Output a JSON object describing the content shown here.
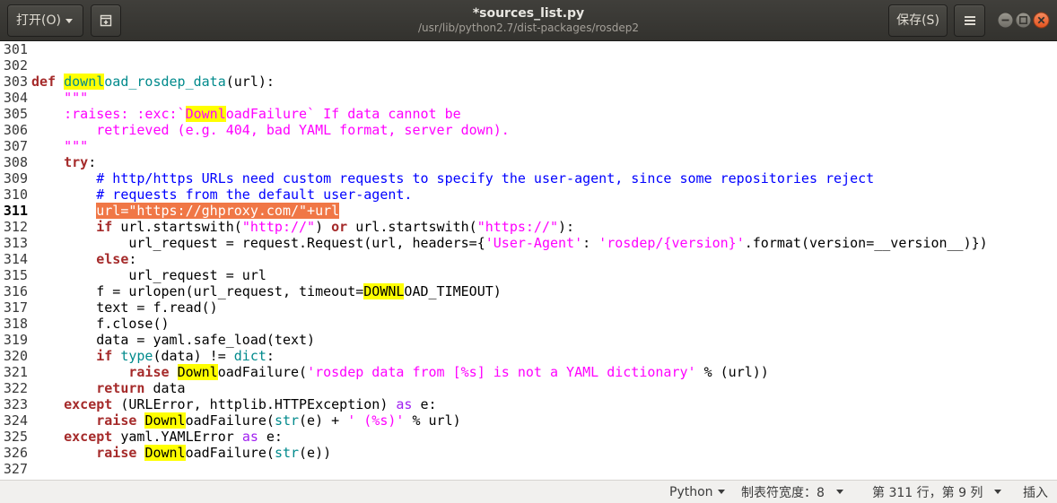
{
  "window": {
    "title": "*sources_list.py",
    "subtitle": "/usr/lib/python2.7/dist-packages/rosdep2"
  },
  "header": {
    "open_label": "打开(O)",
    "save_label": "保存(S)",
    "icons": {
      "open_dropdown": "chevron-down-icon",
      "new_tab": "new-tab-icon",
      "menu": "hamburger-menu-icon",
      "minimize": "minimize-icon",
      "maximize": "maximize-icon",
      "close": "close-icon"
    }
  },
  "syntax_colors": {
    "keyword": "#a52a2a",
    "function": "#008a8c",
    "string": "#ff00ff",
    "comment": "#0000ff",
    "preprocessor": "#a020f0",
    "search_match_background": "#ffff00",
    "selection_background": "#f07746",
    "selection_text": "#ffffff",
    "window_close": "#ef6a3b"
  },
  "editor": {
    "lines": [
      {
        "num": "301",
        "tokens": []
      },
      {
        "num": "302",
        "tokens": []
      },
      {
        "num": "303",
        "tokens": [
          {
            "t": "def",
            "fg": "#a52a2a",
            "bold": true
          },
          {
            "t": " "
          },
          {
            "t": "downl",
            "fg": "#008a8c",
            "bg": "#ffff00"
          },
          {
            "t": "oad_rosdep_data",
            "fg": "#008a8c"
          },
          {
            "t": "(url):"
          }
        ]
      },
      {
        "num": "304",
        "tokens": [
          {
            "t": "    "
          },
          {
            "t": "\"\"\"",
            "fg": "#ff00ff"
          }
        ]
      },
      {
        "num": "305",
        "tokens": [
          {
            "t": "    "
          },
          {
            "t": ":raises: :exc:`",
            "fg": "#ff00ff"
          },
          {
            "t": "Downl",
            "fg": "#ff00ff",
            "bg": "#ffff00"
          },
          {
            "t": "oadFailure` If data cannot be",
            "fg": "#ff00ff"
          }
        ]
      },
      {
        "num": "306",
        "tokens": [
          {
            "t": "        "
          },
          {
            "t": "retrieved (e.g. 404, bad YAML format, server down).",
            "fg": "#ff00ff"
          }
        ]
      },
      {
        "num": "307",
        "tokens": [
          {
            "t": "    "
          },
          {
            "t": "\"\"\"",
            "fg": "#ff00ff"
          }
        ]
      },
      {
        "num": "308",
        "tokens": [
          {
            "t": "    "
          },
          {
            "t": "try",
            "fg": "#a52a2a",
            "bold": true
          },
          {
            "t": ":"
          }
        ]
      },
      {
        "num": "309",
        "tokens": [
          {
            "t": "        "
          },
          {
            "t": "# http/https URLs need custom requests to specify the user-agent, since some repositories reject",
            "fg": "#0000ff"
          }
        ]
      },
      {
        "num": "310",
        "tokens": [
          {
            "t": "        "
          },
          {
            "t": "# requests from the default user-agent.",
            "fg": "#0000ff"
          }
        ]
      },
      {
        "num": "311",
        "current": true,
        "tokens": [
          {
            "t": "        "
          },
          {
            "t": "url=\"https://ghproxy.com/\"+url",
            "fg": "#ffffff",
            "bg": "#f07746"
          }
        ]
      },
      {
        "num": "312",
        "tokens": [
          {
            "t": "        "
          },
          {
            "t": "if",
            "fg": "#a52a2a",
            "bold": true
          },
          {
            "t": " url.startswith("
          },
          {
            "t": "\"http://\"",
            "fg": "#ff00ff"
          },
          {
            "t": ") "
          },
          {
            "t": "or",
            "fg": "#a52a2a",
            "bold": true
          },
          {
            "t": " url.startswith("
          },
          {
            "t": "\"https://\"",
            "fg": "#ff00ff"
          },
          {
            "t": "):"
          }
        ]
      },
      {
        "num": "313",
        "tokens": [
          {
            "t": "            "
          },
          {
            "t": "url_request = request.Request(url, headers={"
          },
          {
            "t": "'User-Agent'",
            "fg": "#ff00ff"
          },
          {
            "t": ": "
          },
          {
            "t": "'rosdep/{version}'",
            "fg": "#ff00ff"
          },
          {
            "t": ".format(version=__version__)})"
          }
        ]
      },
      {
        "num": "314",
        "tokens": [
          {
            "t": "        "
          },
          {
            "t": "else",
            "fg": "#a52a2a",
            "bold": true
          },
          {
            "t": ":"
          }
        ]
      },
      {
        "num": "315",
        "tokens": [
          {
            "t": "            "
          },
          {
            "t": "url_request = url"
          }
        ]
      },
      {
        "num": "316",
        "tokens": [
          {
            "t": "        "
          },
          {
            "t": "f = urlopen(url_request, timeout="
          },
          {
            "t": "DOWNL",
            "bg": "#ffff00"
          },
          {
            "t": "OAD_TIMEOUT)"
          }
        ]
      },
      {
        "num": "317",
        "tokens": [
          {
            "t": "        "
          },
          {
            "t": "text = f.read()"
          }
        ]
      },
      {
        "num": "318",
        "tokens": [
          {
            "t": "        "
          },
          {
            "t": "f.close()"
          }
        ]
      },
      {
        "num": "319",
        "tokens": [
          {
            "t": "        "
          },
          {
            "t": "data = yaml.safe_load(text)"
          }
        ]
      },
      {
        "num": "320",
        "tokens": [
          {
            "t": "        "
          },
          {
            "t": "if",
            "fg": "#a52a2a",
            "bold": true
          },
          {
            "t": " "
          },
          {
            "t": "type",
            "fg": "#008a8c"
          },
          {
            "t": "(data) != "
          },
          {
            "t": "dict",
            "fg": "#008a8c"
          },
          {
            "t": ":"
          }
        ]
      },
      {
        "num": "321",
        "tokens": [
          {
            "t": "            "
          },
          {
            "t": "raise",
            "fg": "#a52a2a",
            "bold": true
          },
          {
            "t": " "
          },
          {
            "t": "Downl",
            "bg": "#ffff00"
          },
          {
            "t": "oadFailure("
          },
          {
            "t": "'rosdep data from [%s] is not a YAML dictionary'",
            "fg": "#ff00ff"
          },
          {
            "t": " % (url))"
          }
        ]
      },
      {
        "num": "322",
        "tokens": [
          {
            "t": "        "
          },
          {
            "t": "return",
            "fg": "#a52a2a",
            "bold": true
          },
          {
            "t": " data"
          }
        ]
      },
      {
        "num": "323",
        "tokens": [
          {
            "t": "    "
          },
          {
            "t": "except",
            "fg": "#a52a2a",
            "bold": true
          },
          {
            "t": " (URLError, httplib.HTTPException) "
          },
          {
            "t": "as",
            "fg": "#a020f0"
          },
          {
            "t": " e:"
          }
        ]
      },
      {
        "num": "324",
        "tokens": [
          {
            "t": "        "
          },
          {
            "t": "raise",
            "fg": "#a52a2a",
            "bold": true
          },
          {
            "t": " "
          },
          {
            "t": "Downl",
            "bg": "#ffff00"
          },
          {
            "t": "oadFailure("
          },
          {
            "t": "str",
            "fg": "#008a8c"
          },
          {
            "t": "(e) + "
          },
          {
            "t": "' (%s)'",
            "fg": "#ff00ff"
          },
          {
            "t": " % url)"
          }
        ]
      },
      {
        "num": "325",
        "tokens": [
          {
            "t": "    "
          },
          {
            "t": "except",
            "fg": "#a52a2a",
            "bold": true
          },
          {
            "t": " yaml.YAMLError "
          },
          {
            "t": "as",
            "fg": "#a020f0"
          },
          {
            "t": " e:"
          }
        ]
      },
      {
        "num": "326",
        "tokens": [
          {
            "t": "        "
          },
          {
            "t": "raise",
            "fg": "#a52a2a",
            "bold": true
          },
          {
            "t": " "
          },
          {
            "t": "Downl",
            "bg": "#ffff00"
          },
          {
            "t": "oadFailure("
          },
          {
            "t": "str",
            "fg": "#008a8c"
          },
          {
            "t": "(e))"
          }
        ]
      },
      {
        "num": "327",
        "tokens": []
      }
    ]
  },
  "statusbar": {
    "language": "Python",
    "tab_width": "制表符宽度：8",
    "cursor_position": "第 311 行，第 9 列",
    "input_mode": "插入"
  }
}
